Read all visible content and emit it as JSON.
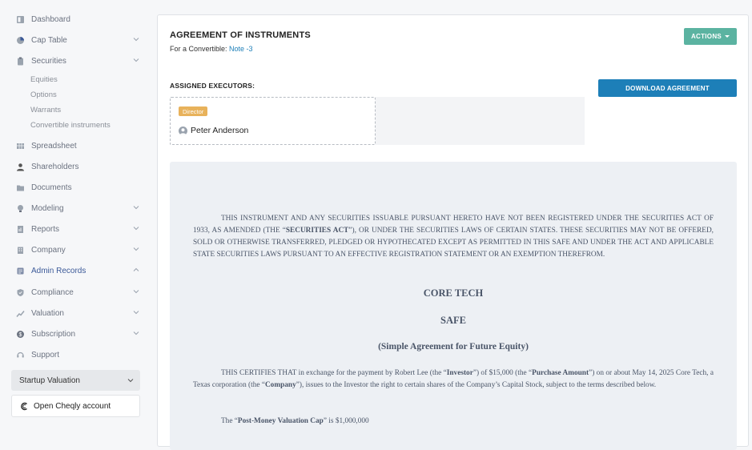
{
  "sidebar": {
    "items": [
      {
        "label": "Dashboard",
        "icon": "dashboard-icon",
        "chevron": false
      },
      {
        "label": "Cap Table",
        "icon": "pie-chart-icon",
        "chevron": true
      },
      {
        "label": "Securities",
        "icon": "clipboard-icon",
        "chevron": true
      },
      {
        "label": "Spreadsheet",
        "icon": "spreadsheet-icon",
        "chevron": false
      },
      {
        "label": "Shareholders",
        "icon": "user-icon",
        "chevron": false
      },
      {
        "label": "Documents",
        "icon": "folder-icon",
        "chevron": false
      },
      {
        "label": "Modeling",
        "icon": "lightbulb-icon",
        "chevron": true
      },
      {
        "label": "Reports",
        "icon": "report-icon",
        "chevron": true
      },
      {
        "label": "Company",
        "icon": "building-icon",
        "chevron": true
      },
      {
        "label": "Admin Records",
        "icon": "admin-records-icon",
        "chevron": true,
        "active": true
      },
      {
        "label": "Compliance",
        "icon": "shield-check-icon",
        "chevron": true
      },
      {
        "label": "Valuation",
        "icon": "valuation-icon",
        "chevron": true
      },
      {
        "label": "Subscription",
        "icon": "dollar-icon",
        "chevron": true
      },
      {
        "label": "Support",
        "icon": "support-icon",
        "chevron": false
      }
    ],
    "securities_sub": [
      "Equities",
      "Options",
      "Warrants",
      "Convertible instruments"
    ],
    "startup_valuation": "Startup Valuation",
    "open_account": "Open Cheqly account"
  },
  "header": {
    "title": "AGREEMENT OF INSTRUMENTS",
    "subtitle_prefix": "For a Convertible: ",
    "subtitle_link": "Note -3",
    "actions_label": "ACTIONS"
  },
  "executors": {
    "label": "ASSIGNED EXECUTORS:",
    "download_label": "DOWNLOAD AGREEMENT",
    "role": "Director",
    "name": "Peter Anderson"
  },
  "document": {
    "legend_1": "THIS INSTRUMENT AND ANY SECURITIES ISSUABLE PURSUANT HERETO HAVE NOT BEEN REGISTERED UNDER THE SECURITIES ACT OF 1933, AS AMENDED (THE “",
    "legend_bold": "SECURITIES ACT",
    "legend_2": "”), OR UNDER THE SECURITIES LAWS OF CERTAIN STATES. THESE SECURITIES MAY NOT BE OFFERED, SOLD OR OTHERWISE TRANSFERRED, PLEDGED OR HYPOTHECATED EXCEPT AS PERMITTED IN THIS SAFE AND UNDER THE ACT AND APPLICABLE STATE SECURITIES LAWS PURSUANT TO AN EFFECTIVE REGISTRATION STATEMENT OR AN EXEMPTION THEREFROM.",
    "company": "CORE TECH",
    "doc_type": "SAFE",
    "doc_subtitle": "(Simple Agreement for Future Equity)",
    "p1_a": "THIS CERTIFIES THAT in exchange for the payment by Robert Lee (the “",
    "p1_investor": "Investor",
    "p1_b": "”) of $15,000 (the “",
    "p1_purchase": "Purchase Amount",
    "p1_c": "”) on or about May 14, 2025 Core Tech, a Texas corporation (the “",
    "p1_company": "Company",
    "p1_d": "”), issues to the Investor the right to certain shares of the Company’s Capital Stock, subject to the terms described below.",
    "p2_a": "The “",
    "p2_bold": "Post-Money Valuation Cap",
    "p2_b": "” is $1,000,000"
  },
  "colors": {
    "actions": "#5bb3a1",
    "download": "#1d7fb8",
    "badge": "#e8b25b",
    "active_nav": "#3b5998"
  }
}
